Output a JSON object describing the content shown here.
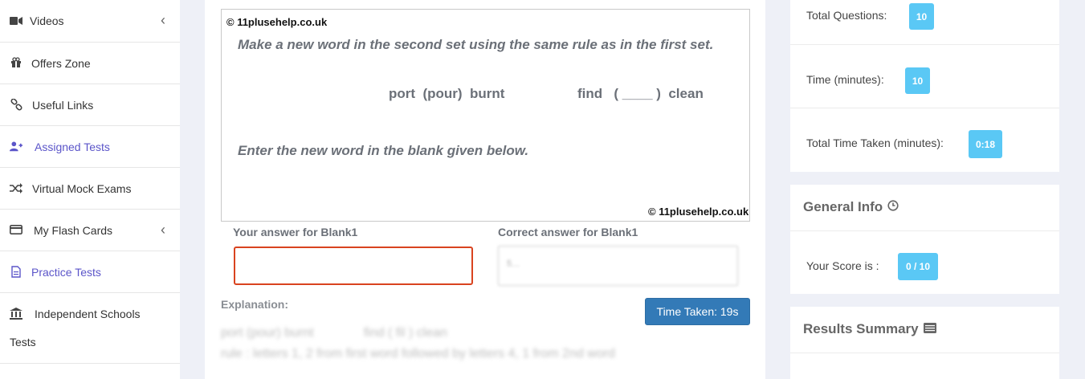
{
  "sidebar": {
    "items": [
      {
        "label": "Videos",
        "icon": "video-icon"
      },
      {
        "label": "Offers Zone",
        "icon": "gift-icon"
      },
      {
        "label": "Useful Links",
        "icon": "link-icon"
      },
      {
        "label": "Assigned Tests",
        "icon": "user-plus-icon"
      },
      {
        "label": "Virtual Mock Exams",
        "icon": "shuffle-icon"
      },
      {
        "label": "My Flash Cards",
        "icon": "card-icon"
      },
      {
        "label": "Practice Tests",
        "icon": "file-icon"
      },
      {
        "label": "Independent Schools",
        "label2": "Tests",
        "icon": "institution-icon"
      }
    ]
  },
  "question": {
    "copyright_top": "© 11plusehelp.co.uk",
    "copyright_bottom": "© 11plusehelp.co.uk",
    "instruction": "Make a new word in the second set using the same rule as in the first set.",
    "set1": "port  (pour)  burnt",
    "set2": "find   ( ____ )  clean",
    "prompt": "Enter the new word in the blank given below."
  },
  "answer": {
    "your_label": "Your answer for Blank1",
    "your_value": "",
    "correct_label": "Correct answer for Blank1",
    "correct_value": "fi..."
  },
  "explanation": {
    "label": "Explanation:",
    "time_taken": "Time Taken: 19s",
    "line1": "port (pour) burnt              find ( fil ) clean",
    "line2": "rule : letters 1, 2 from first word followed by letters 4, 1 from 2nd word"
  },
  "stats": {
    "total_questions_label": "Total Questions:",
    "total_questions": "10",
    "time_label": "Time (minutes):",
    "time": "10",
    "total_time_label": "Total Time Taken (minutes):",
    "total_time": "0:18"
  },
  "general_info": {
    "title": "General Info",
    "score_label": "Your Score is :",
    "score": "0 / 10"
  },
  "results_summary": {
    "title": "Results Summary"
  },
  "colors": {
    "accent": "#337ab7",
    "badge": "#5ac8f5",
    "answer_border": "#d9431f",
    "purple": "#5b55c9"
  }
}
